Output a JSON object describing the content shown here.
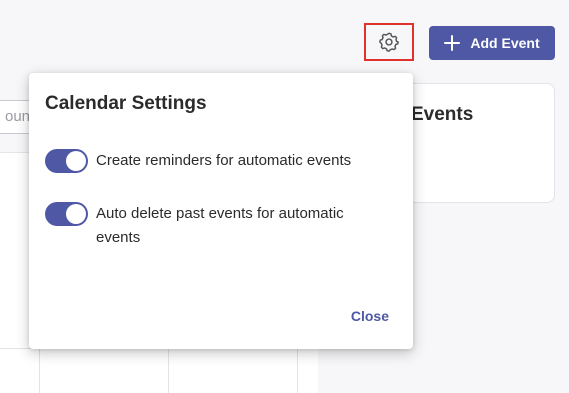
{
  "colors": {
    "accent": "#4f58a5",
    "highlight_border": "#e0322d"
  },
  "header": {
    "settings_icon": "gear-icon",
    "add_event_icon": "plus-icon",
    "add_event_label": "Add Event"
  },
  "background": {
    "search_fragment": "ount(",
    "events_card_title_fragment": "Events"
  },
  "settings_dialog": {
    "title": "Calendar Settings",
    "settings": [
      {
        "label": "Create reminders for automatic events",
        "enabled": true
      },
      {
        "label": "Auto delete past events for automatic events",
        "enabled": true
      }
    ],
    "close_label": "Close"
  }
}
